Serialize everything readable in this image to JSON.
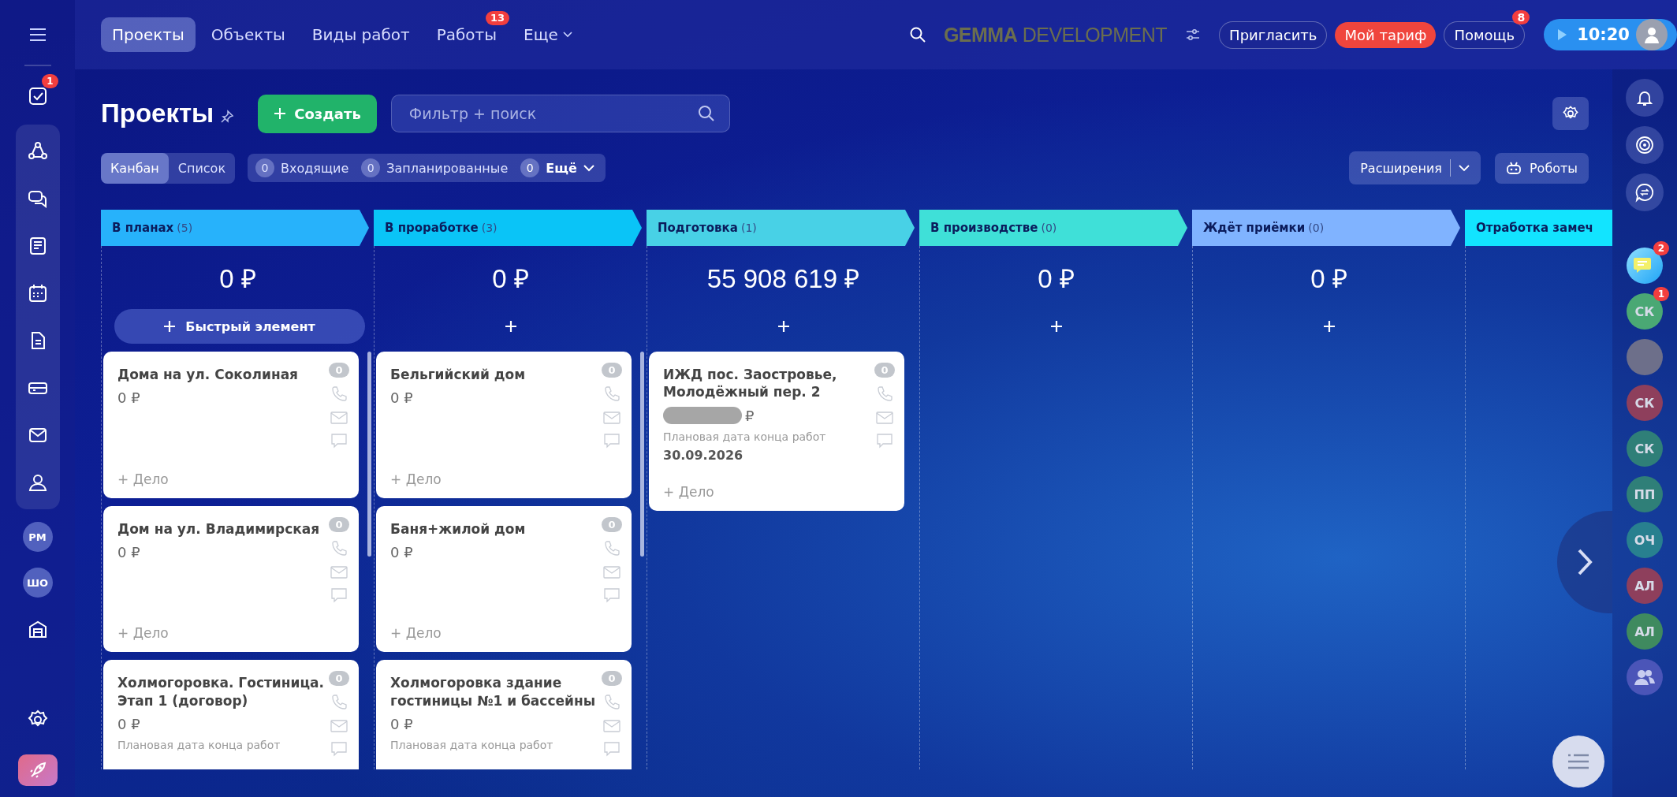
{
  "nav": {
    "tabs": [
      {
        "label": "Проекты",
        "selected": true,
        "dropdown": false
      },
      {
        "label": "Объекты",
        "selected": false,
        "dropdown": false
      },
      {
        "label": "Виды работ",
        "selected": false,
        "dropdown": false
      },
      {
        "label": "Работы",
        "selected": false,
        "dropdown": false,
        "badge": "13"
      },
      {
        "label": "Еще",
        "selected": false,
        "dropdown": true
      }
    ]
  },
  "logo": {
    "bold": "GEMMA",
    "rest": "DEVELOPMENT"
  },
  "header_buttons": [
    {
      "label": "Пригласить",
      "kind": "outline"
    },
    {
      "label": "Мой тариф",
      "kind": "accent"
    },
    {
      "label": "Помощь",
      "kind": "outline",
      "badge": "8"
    }
  ],
  "timer": {
    "time": "10:20"
  },
  "left_sidebar": {
    "tasks_badge": "1",
    "avatars": [
      "РМ",
      "ШО"
    ]
  },
  "page": {
    "title": "Проекты",
    "create_button": "Создать",
    "search_placeholder": "Фильтр + поиск"
  },
  "view_switch": [
    {
      "label": "Канбан",
      "selected": true
    },
    {
      "label": "Список",
      "selected": false
    }
  ],
  "counters": [
    {
      "count": "0",
      "label": "Входящие",
      "dropdown": false
    },
    {
      "count": "0",
      "label": "Запланированные",
      "dropdown": false
    },
    {
      "count": "0",
      "label": "Ещё",
      "dropdown": true
    }
  ],
  "extensions_button": "Расширения",
  "robots_button": "Роботы",
  "columns": [
    {
      "name": "В планах",
      "count": "(5)",
      "color": "#27b2fb",
      "sum": "0 ₽",
      "add_label": "Быстрый элемент",
      "cards": [
        {
          "title": "Дома на ул. Соколиная",
          "amount": "0 ₽",
          "masked": false,
          "counter": "0",
          "action": "+ Дело"
        },
        {
          "title": "Дом на ул. Владимирская",
          "amount": "0 ₽",
          "masked": false,
          "counter": "0",
          "action": "+ Дело"
        },
        {
          "title": "Холмогоровка. Гостиница. Этап 1 (договор)",
          "amount": "0 ₽",
          "masked": false,
          "counter": "0",
          "date_label": "Плановая дата конца работ"
        }
      ]
    },
    {
      "name": "В проработке",
      "count": "(3)",
      "color": "#0ac4f7",
      "sum": "0 ₽",
      "cards": [
        {
          "title": "Бельгийский дом",
          "amount": "0 ₽",
          "masked": false,
          "counter": "0",
          "action": "+ Дело"
        },
        {
          "title": "Баня+жилой дом",
          "amount": "0 ₽",
          "masked": false,
          "counter": "0",
          "action": "+ Дело"
        },
        {
          "title": "Холмогоровка здание гостиницы №1 и бассейны",
          "amount": "0 ₽",
          "masked": false,
          "counter": "0",
          "date_label": "Плановая дата конца работ"
        }
      ]
    },
    {
      "name": "Подготовка",
      "count": "(1)",
      "color": "#48d1e6",
      "sum": "55 908 619 ₽",
      "cards": [
        {
          "title": "ИЖД пос. Заостровье, Молодёжный пер. 2",
          "amount": "₽",
          "masked": true,
          "counter": "0",
          "date_label": "Плановая дата конца работ",
          "date": "30.09.2026",
          "action": "+ Дело"
        }
      ]
    },
    {
      "name": "В производстве",
      "count": "(0)",
      "color": "#3fe0d8",
      "sum": "0 ₽"
    },
    {
      "name": "Ждёт приёмки",
      "count": "(0)",
      "color": "#80b3ff",
      "sum": "0 ₽"
    },
    {
      "name": "Отработка замеч",
      "color": "#12e4ff"
    }
  ],
  "right_sidebar": {
    "chat_badge": "2",
    "contacts": [
      {
        "kind": "initials",
        "initials": "СК",
        "color": "#4aa874",
        "badge": "1"
      },
      {
        "kind": "photo"
      },
      {
        "kind": "initials",
        "initials": "СК",
        "color": "#8e3f5c"
      },
      {
        "kind": "initials",
        "initials": "СК",
        "color": "#2f7f78"
      },
      {
        "kind": "initials",
        "initials": "ПП",
        "color": "#2f7f78"
      },
      {
        "kind": "initials",
        "initials": "ОЧ",
        "color": "#28808f"
      },
      {
        "kind": "initials",
        "initials": "АЛ",
        "color": "#8e3f5c"
      },
      {
        "kind": "initials",
        "initials": "АЛ",
        "color": "#3f8a5f"
      },
      {
        "kind": "group",
        "color": "#4b55b8"
      }
    ]
  }
}
